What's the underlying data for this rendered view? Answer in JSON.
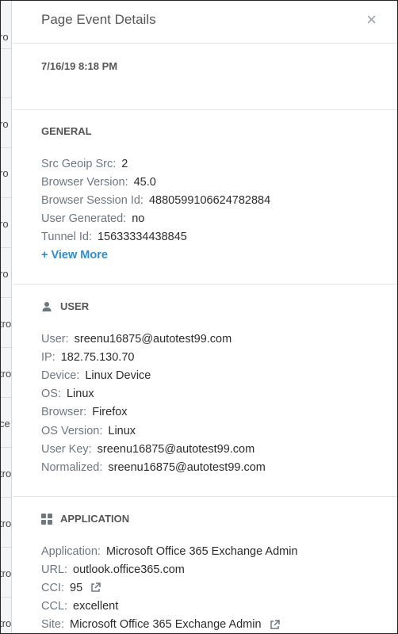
{
  "background": {
    "fragments": [
      "ro",
      "ro",
      "ro",
      "ro",
      "tro",
      "tro",
      "ce",
      "tro",
      "tro",
      "tro",
      "tro"
    ]
  },
  "header": {
    "title": "Page Event Details",
    "close_symbol": "×"
  },
  "event": {
    "date": "7/16/19 8:18 PM"
  },
  "general": {
    "heading": "GENERAL",
    "rows": [
      {
        "label": "Src Geoip Src:",
        "value": "2"
      },
      {
        "label": "Browser Version:",
        "value": "45.0"
      },
      {
        "label": "Browser Session Id:",
        "value": "4880599106624782884"
      },
      {
        "label": "User Generated:",
        "value": "no"
      },
      {
        "label": "Tunnel Id:",
        "value": "15633334438845"
      }
    ],
    "view_more": "+ View More"
  },
  "user": {
    "heading": "USER",
    "icon": "user-icon",
    "rows": [
      {
        "label": "User:",
        "value": "sreenu16875@autotest99.com"
      },
      {
        "label": "IP:",
        "value": "182.75.130.70"
      },
      {
        "label": "Device:",
        "value": "Linux Device"
      },
      {
        "label": "OS:",
        "value": "Linux"
      },
      {
        "label": "Browser:",
        "value": "Firefox"
      },
      {
        "label": "OS Version:",
        "value": "Linux"
      },
      {
        "label": "User Key:",
        "value": "sreenu16875@autotest99.com"
      },
      {
        "label": "Normalized:",
        "value": "sreenu16875@autotest99.com"
      }
    ]
  },
  "application": {
    "heading": "APPLICATION",
    "icon": "apps-grid-icon",
    "rows": [
      {
        "label": "Application:",
        "value": "Microsoft Office 365 Exchange Admin"
      },
      {
        "label": "URL:",
        "value": "outlook.office365.com"
      },
      {
        "label": "CCI:",
        "value": "95"
      },
      {
        "label": "CCL:",
        "value": "excellent"
      },
      {
        "label": "Site:",
        "value": "Microsoft Office 365 Exchange Admin"
      }
    ]
  },
  "colors": {
    "accent_link": "#2c8ed0",
    "label": "#6d7780",
    "value": "#2b2b2b",
    "divider": "#e2e4e6"
  }
}
